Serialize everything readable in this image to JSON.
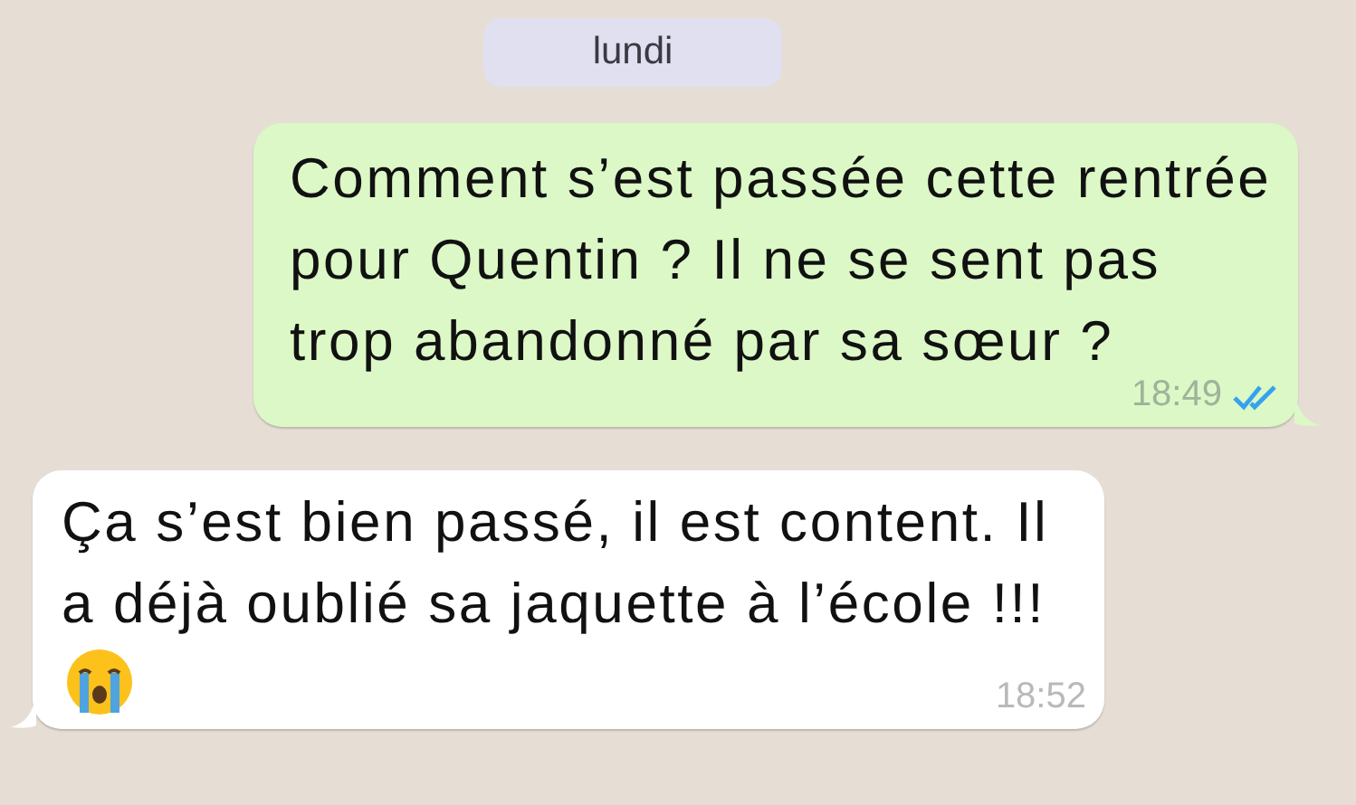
{
  "date_chip": "lundi",
  "messages": [
    {
      "kind": "outgoing",
      "text": "Comment s’est passée cette rentrée pour Quentin ? Il ne se sent pas trop abandonné par sa sœur ?",
      "time": "18:49",
      "read": true
    },
    {
      "kind": "incoming",
      "text": "Ça s’est bien passé, il est content. Il a déjà oublié sa jaquette à l’école !!!",
      "time": "18:52",
      "emoji": true
    }
  ]
}
